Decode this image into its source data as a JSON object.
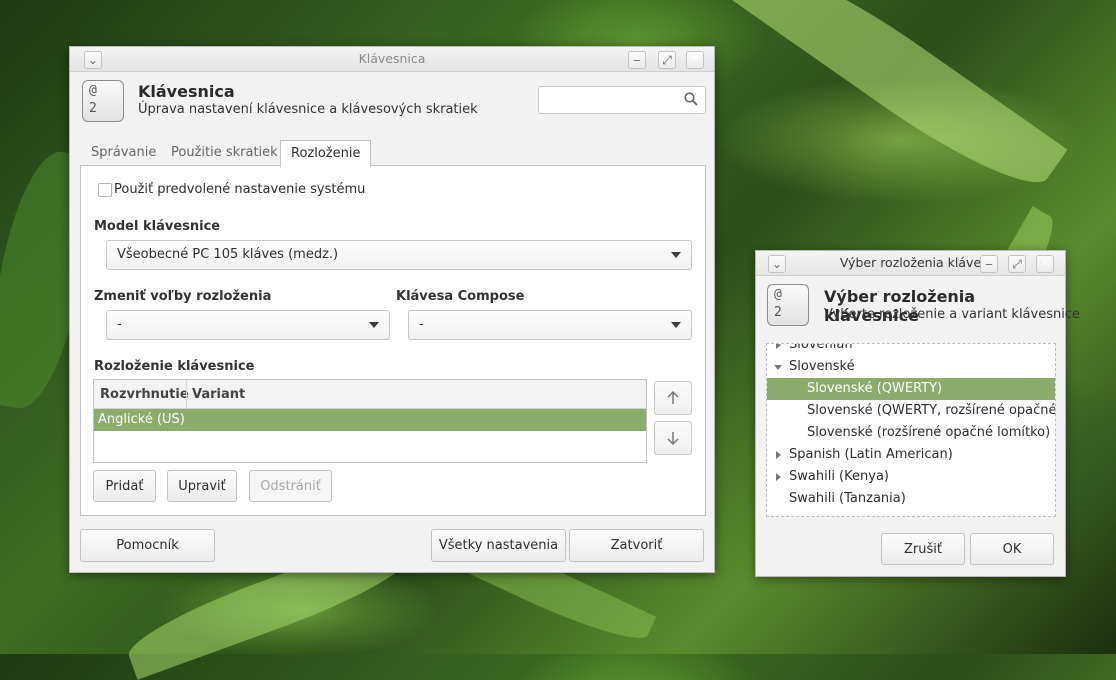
{
  "main_window": {
    "title": "Klávesnica",
    "header_title": "Klávesnica",
    "header_subtitle": "Úprava nastavení klávesnice a klávesových skratiek",
    "icon_text": [
      "@",
      "2"
    ],
    "search": {
      "value": "",
      "placeholder": ""
    },
    "tabs": [
      {
        "label": "Správanie",
        "active": false
      },
      {
        "label": "Použitie skratiek",
        "active": false
      },
      {
        "label": "Rozloženie",
        "active": true
      }
    ],
    "use_system_defaults_label": "Použiť predvolené nastavenie systému",
    "keyboard_model_label": "Model klávesnice",
    "keyboard_model_value": "Všeobecné PC 105 kláves (medz.)",
    "layout_options_label": "Zmeniť voľby rozloženia",
    "layout_options_value": "-",
    "compose_key_label": "Klávesa Compose",
    "compose_key_value": "-",
    "layouts_label": "Rozloženie klávesnice",
    "layouts_table": {
      "columns": [
        "Rozvrhnutie",
        "Variant"
      ],
      "rows": [
        {
          "layout": "Anglické (US)",
          "variant": ""
        }
      ]
    },
    "buttons": {
      "add": "Pridať",
      "edit": "Upraviť",
      "remove": "Odstrániť",
      "help": "Pomocník",
      "all_settings": "Všetky nastavenia",
      "close": "Zatvoriť"
    }
  },
  "layout_dialog": {
    "title": "Výber rozloženia kláve",
    "header_title": "Výber rozloženia klávesnice",
    "header_subtitle": "Vyberte rozloženie a variant klávesnice",
    "icon_text": [
      "@",
      "2"
    ],
    "tree_items": [
      {
        "label": "Slovenian",
        "level": 0,
        "expander": "collapsed"
      },
      {
        "label": "Slovenské",
        "level": 0,
        "expander": "expanded"
      },
      {
        "label": "Slovenské (QWERTY)",
        "level": 1,
        "selected": true
      },
      {
        "label": "Slovenské (QWERTY, rozšírené opačné lomítko)",
        "level": 1
      },
      {
        "label": "Slovenské (rozšírené opačné lomítko)",
        "level": 1
      },
      {
        "label": "Spanish (Latin American)",
        "level": 0,
        "expander": "collapsed"
      },
      {
        "label": "Swahili (Kenya)",
        "level": 0,
        "expander": "collapsed"
      },
      {
        "label": "Swahili (Tanzania)",
        "level": 0,
        "expander": "none"
      }
    ],
    "buttons": {
      "cancel": "Zrušiť",
      "ok": "OK"
    }
  },
  "colors": {
    "selection": "#8aad6b",
    "dialog_close": "#8fbf5a"
  }
}
